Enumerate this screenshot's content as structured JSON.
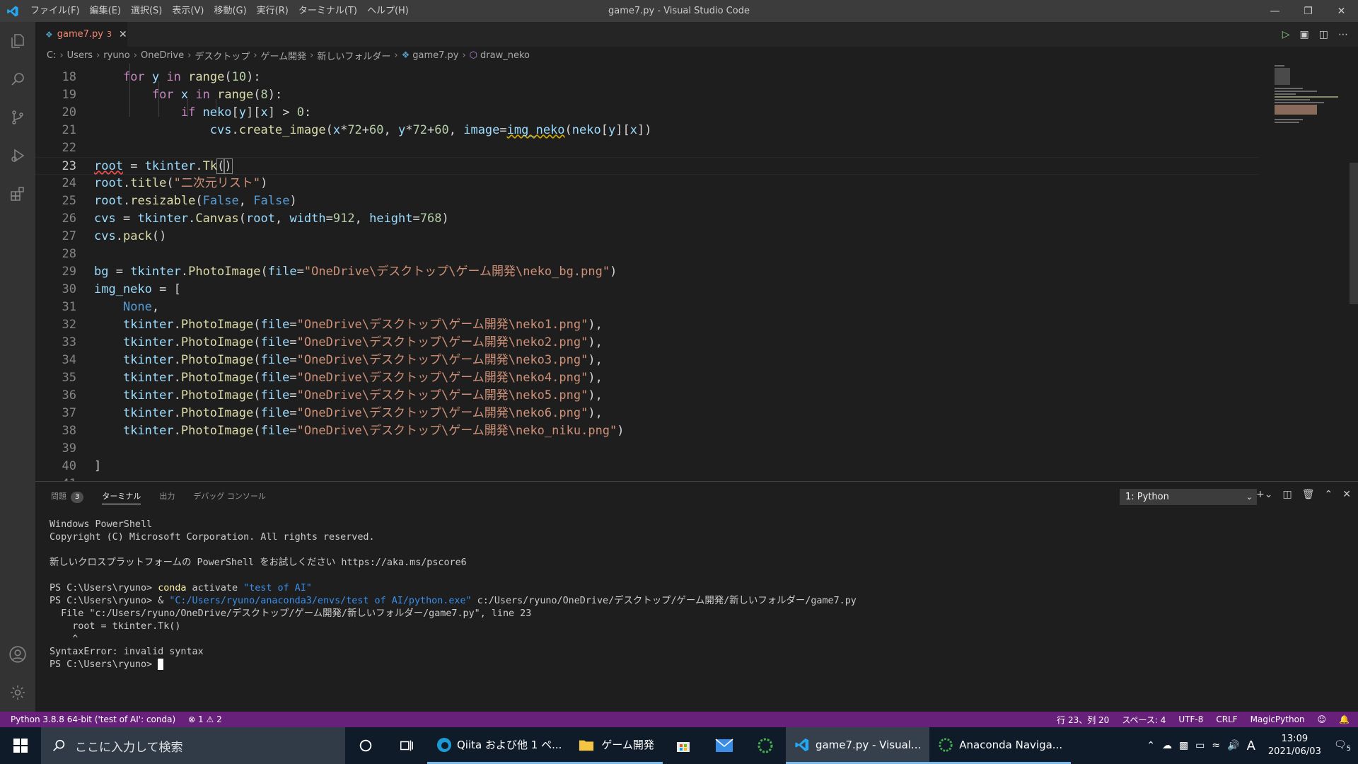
{
  "window": {
    "title": "game7.py - Visual Studio Code",
    "menus": [
      "ファイル(F)",
      "編集(E)",
      "選択(S)",
      "表示(V)",
      "移動(G)",
      "実行(R)",
      "ターミナル(T)",
      "ヘルプ(H)"
    ]
  },
  "tab": {
    "name": "game7.py",
    "problems": "3"
  },
  "breadcrumb": [
    "C:",
    "Users",
    "ryuno",
    "OneDrive",
    "デスクトップ",
    "ゲーム開発",
    "新しいフォルダー",
    "game7.py",
    "draw_neko"
  ],
  "editor": {
    "line_numbers": [
      "18",
      "19",
      "20",
      "21",
      "22",
      "23",
      "24",
      "25",
      "26",
      "27",
      "28",
      "29",
      "30",
      "31",
      "32",
      "33",
      "34",
      "35",
      "36",
      "37",
      "38",
      "39",
      "40"
    ],
    "current_line": "23",
    "last_partial_line": "41"
  },
  "panel": {
    "tabs": [
      "問題",
      "ターミナル",
      "出力",
      "デバッグ コンソール"
    ],
    "problems_count": "3",
    "terminal_select": "1: Python",
    "terminal_lines": {
      "l1": "Windows PowerShell",
      "l2": "Copyright (C) Microsoft Corporation. All rights reserved.",
      "l3": "新しいクロスプラットフォームの PowerShell をお試しください https://aka.ms/pscore6",
      "prompt": "PS C:\\Users\\ryuno> ",
      "cmd1": "conda",
      "cmd1_arg": " activate ",
      "cmd1_str": "\"test of AI\"",
      "cmd2_amp": "& ",
      "cmd2_str": "\"C:/Users/ryuno/anaconda3/envs/test of AI/python.exe\"",
      "cmd2_arg": " c:/Users/ryuno/OneDrive/デスクトップ/ゲーム開発/新しいフォルダー/game7.py",
      "err1": "  File \"c:/Users/ryuno/OneDrive/デスクトップ/ゲーム開発/新しいフォルダー/game7.py\", line 23",
      "err2": "    root = tkinter.Tk()",
      "err3": "    ^",
      "err4": "SyntaxError: invalid syntax"
    }
  },
  "statusbar": {
    "interpreter": "Python 3.8.8 64-bit ('test of AI': conda)",
    "errors": "1",
    "warnings": "2",
    "position": "行 23、列 20",
    "spaces": "スペース: 4",
    "encoding": "UTF-8",
    "eol": "CRLF",
    "language": "MagicPython"
  },
  "taskbar": {
    "search_placeholder": "ここに入力して検索",
    "apps": [
      "Qiita および他 1 ペ...",
      "ゲーム開発",
      "game7.py - Visual...",
      "Anaconda Naviga..."
    ],
    "time": "13:09",
    "date": "2021/06/03",
    "ime": "A",
    "notifications": "5"
  },
  "colors": {
    "statusbar": "#68217a",
    "titlebar": "#3c3c3c",
    "activitybar": "#333333",
    "editor": "#1e1e1e",
    "accent": "#007acc"
  }
}
